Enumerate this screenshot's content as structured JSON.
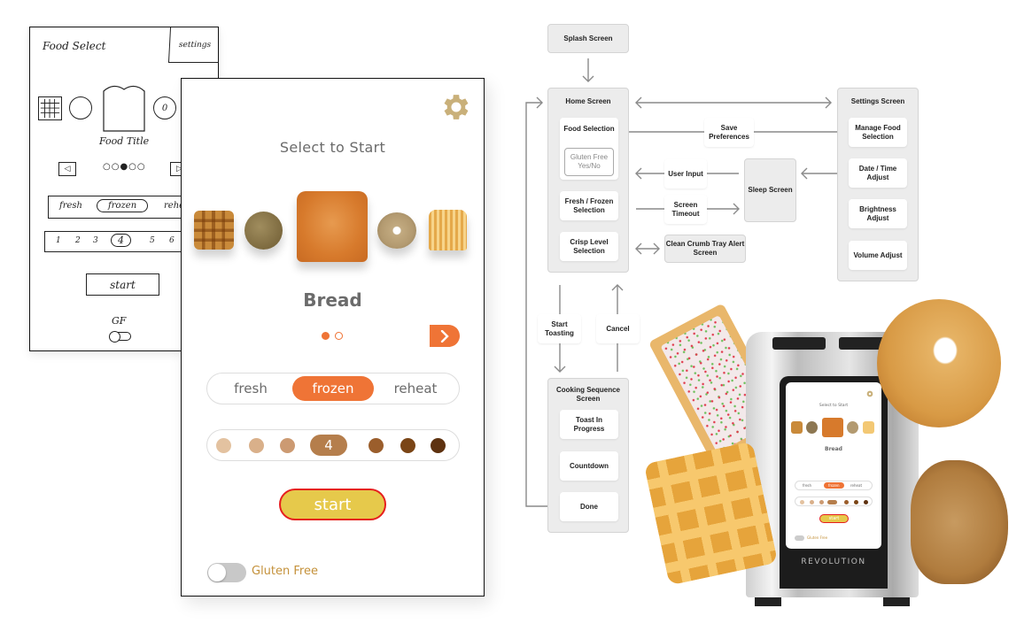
{
  "sketch": {
    "title": "Food Select",
    "settings_label": "settings",
    "bagel_label": "0",
    "food_title": "Food Title",
    "prev_glyph": "◁",
    "next_glyph": "▷",
    "page_dots": "○○●○○",
    "modes": [
      "fresh",
      "frozen",
      "rehe"
    ],
    "levels": [
      "1",
      "2",
      "3",
      "4",
      "5",
      "6"
    ],
    "selected_level": "4",
    "start_label": "start",
    "gf_label": "GF"
  },
  "mockup": {
    "heading": "Select to Start",
    "foods": [
      "waffle",
      "english-muffin",
      "bread",
      "bagel",
      "toaster-pastry"
    ],
    "selected_food": "Bread",
    "pager": {
      "current": 1,
      "total": 2
    },
    "next_glyph": "›",
    "modes": [
      "fresh",
      "frozen",
      "reheat"
    ],
    "selected_mode": "frozen",
    "crisp_levels": [
      {
        "level": 1,
        "color": "#e3c2a0"
      },
      {
        "level": 2,
        "color": "#d9b08a"
      },
      {
        "level": 3,
        "color": "#cc9a72"
      },
      {
        "level": 4,
        "color": "#b57e4c"
      },
      {
        "level": 5,
        "color": "#9b5e2c"
      },
      {
        "level": 6,
        "color": "#7a4516"
      },
      {
        "level": 7,
        "color": "#5e3210"
      }
    ],
    "selected_crisp_label": "4",
    "start_label": "start",
    "gluten_free_label": "Gluten Free",
    "gluten_free_on": false,
    "colors": {
      "accent": "#ef7436",
      "gear": "#c9b07a",
      "start": "#e6c94b",
      "start_border": "#e61e1e",
      "gf_text": "#c4913a"
    }
  },
  "flow": {
    "splash": "Splash Screen",
    "home": "Home Screen",
    "food_selection": "Food Selection",
    "gluten_free": "Gluten Free Yes/No",
    "fresh_frozen": "Fresh / Frozen Selection",
    "crisp_level": "Crisp Level Selection",
    "save_prefs": "Save Preferences",
    "user_input": "User Input",
    "screen_timeout": "Screen Timeout",
    "sleep": "Sleep Screen",
    "crumb_tray": "Clean Crumb Tray Alert Screen",
    "settings": "Settings Screen",
    "manage_food": "Manage Food Selection",
    "date_time": "Date / Time Adjust",
    "brightness": "Brightness Adjust",
    "volume": "Volume Adjust",
    "start_toasting": "Start Toasting",
    "cancel": "Cancel",
    "cooking": "Cooking Sequence Screen",
    "toast_in_progress": "Toast In Progress",
    "countdown": "Countdown",
    "done": "Done"
  },
  "toaster": {
    "brand": "REVOLUTION",
    "screen_heading": "Select to Start",
    "screen_food": "Bread",
    "screen_modes": [
      "fresh",
      "frozen",
      "reheat"
    ],
    "screen_level": "4",
    "screen_start": "start",
    "screen_gf": "Gluten Free"
  }
}
